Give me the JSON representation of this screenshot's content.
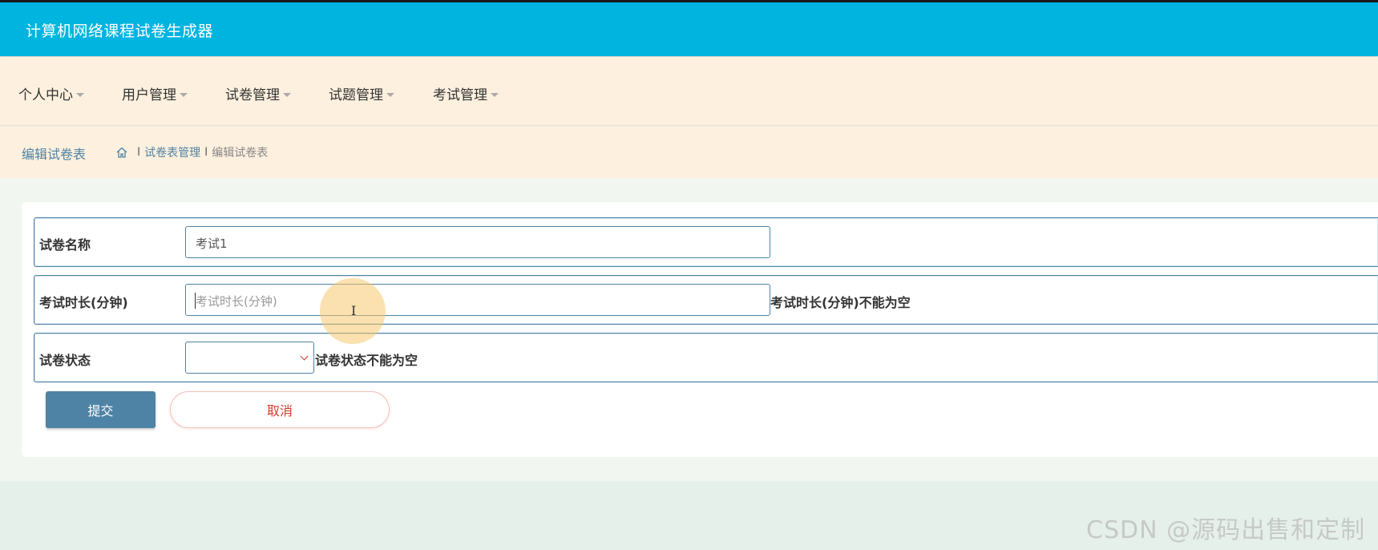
{
  "header": {
    "title": "计算机网络课程试卷生成器"
  },
  "nav": {
    "items": [
      {
        "label": "个人中心"
      },
      {
        "label": "用户管理"
      },
      {
        "label": "试卷管理"
      },
      {
        "label": "试题管理"
      },
      {
        "label": "考试管理"
      }
    ]
  },
  "breadcrumb": {
    "page_title": "编辑试卷表",
    "home_icon": "home-icon",
    "path": [
      "试卷表管理",
      "编辑试卷表"
    ],
    "separator": "I"
  },
  "form": {
    "fields": [
      {
        "label": "试卷名称",
        "value": "考试1",
        "placeholder": "",
        "error": ""
      },
      {
        "label": "考试时长(分钟)",
        "value": "",
        "placeholder": "考试时长(分钟)",
        "error": "考试时长(分钟)不能为空"
      },
      {
        "label": "试卷状态",
        "value": "",
        "error": "试卷状态不能为空"
      }
    ],
    "submit_label": "提交",
    "cancel_label": "取消"
  },
  "watermark": "CSDN @源码出售和定制",
  "colors": {
    "header_bg": "#00b4e0",
    "nav_bg": "#fdf0de",
    "accent": "#4f83a6",
    "cancel_text": "#d23b2b"
  }
}
